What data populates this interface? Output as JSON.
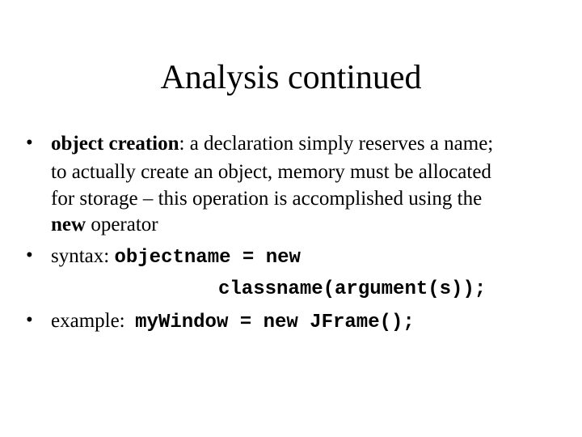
{
  "slide": {
    "title": "Analysis continued",
    "bullets": [
      {
        "term": "object creation",
        "after_term": ": a declaration simply reserves a name;",
        "line2": "to actually create an object, memory must be allocated",
        "line3": "for storage – this operation is accomplished using the",
        "line4_bold": "new",
        "line4_rest": " operator"
      },
      {
        "label": "syntax: ",
        "code1": "objectname = new",
        "code2": "classname(argument(s));"
      },
      {
        "label": "example:  ",
        "code": "myWindow = new JFrame();"
      }
    ],
    "bullet_glyph": "•"
  }
}
